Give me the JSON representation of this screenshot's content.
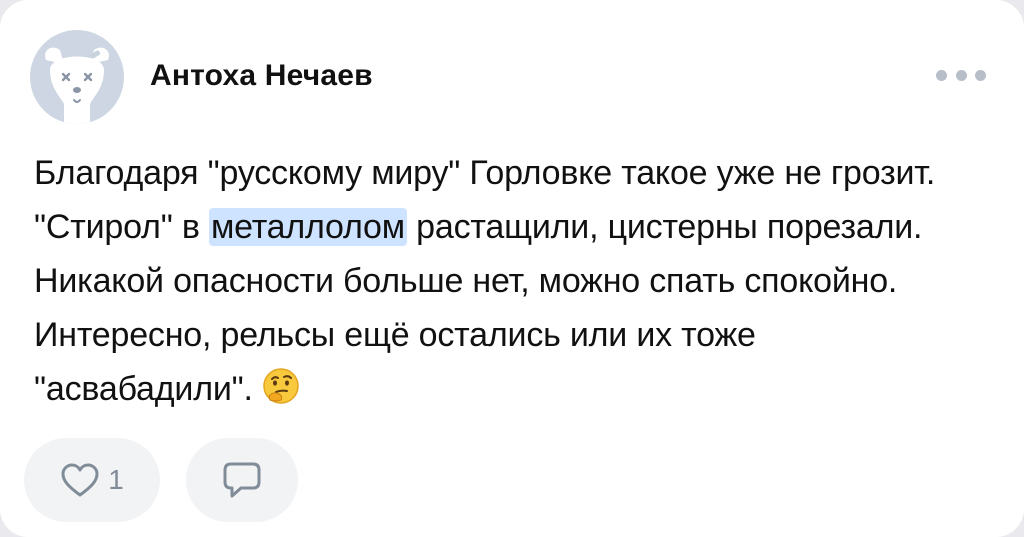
{
  "post": {
    "author": "Антоха Нечаев",
    "text_before": "Благодаря \"русскому миру\" Горловке такое уже не грозит. \"Стирол\" в ",
    "highlighted": "металлолом",
    "text_after": " растащили, цистерны порезали. Никакой опасности больше нет, можно спать спокойно. Интересно, рельсы ещё остались или их тоже \"асвабадили\".",
    "emoji": "thinking-face"
  },
  "actions": {
    "like_count": "1",
    "like_icon": "heart-outline-icon",
    "comment_icon": "comment-bubble-icon",
    "more_icon": "more-dots-icon"
  },
  "colors": {
    "card_background": "#ffffff",
    "avatar_background": "#cdd6e2",
    "highlight": "#cde3ff",
    "icon_gray": "#818c99",
    "pill_background": "#f2f3f5"
  }
}
